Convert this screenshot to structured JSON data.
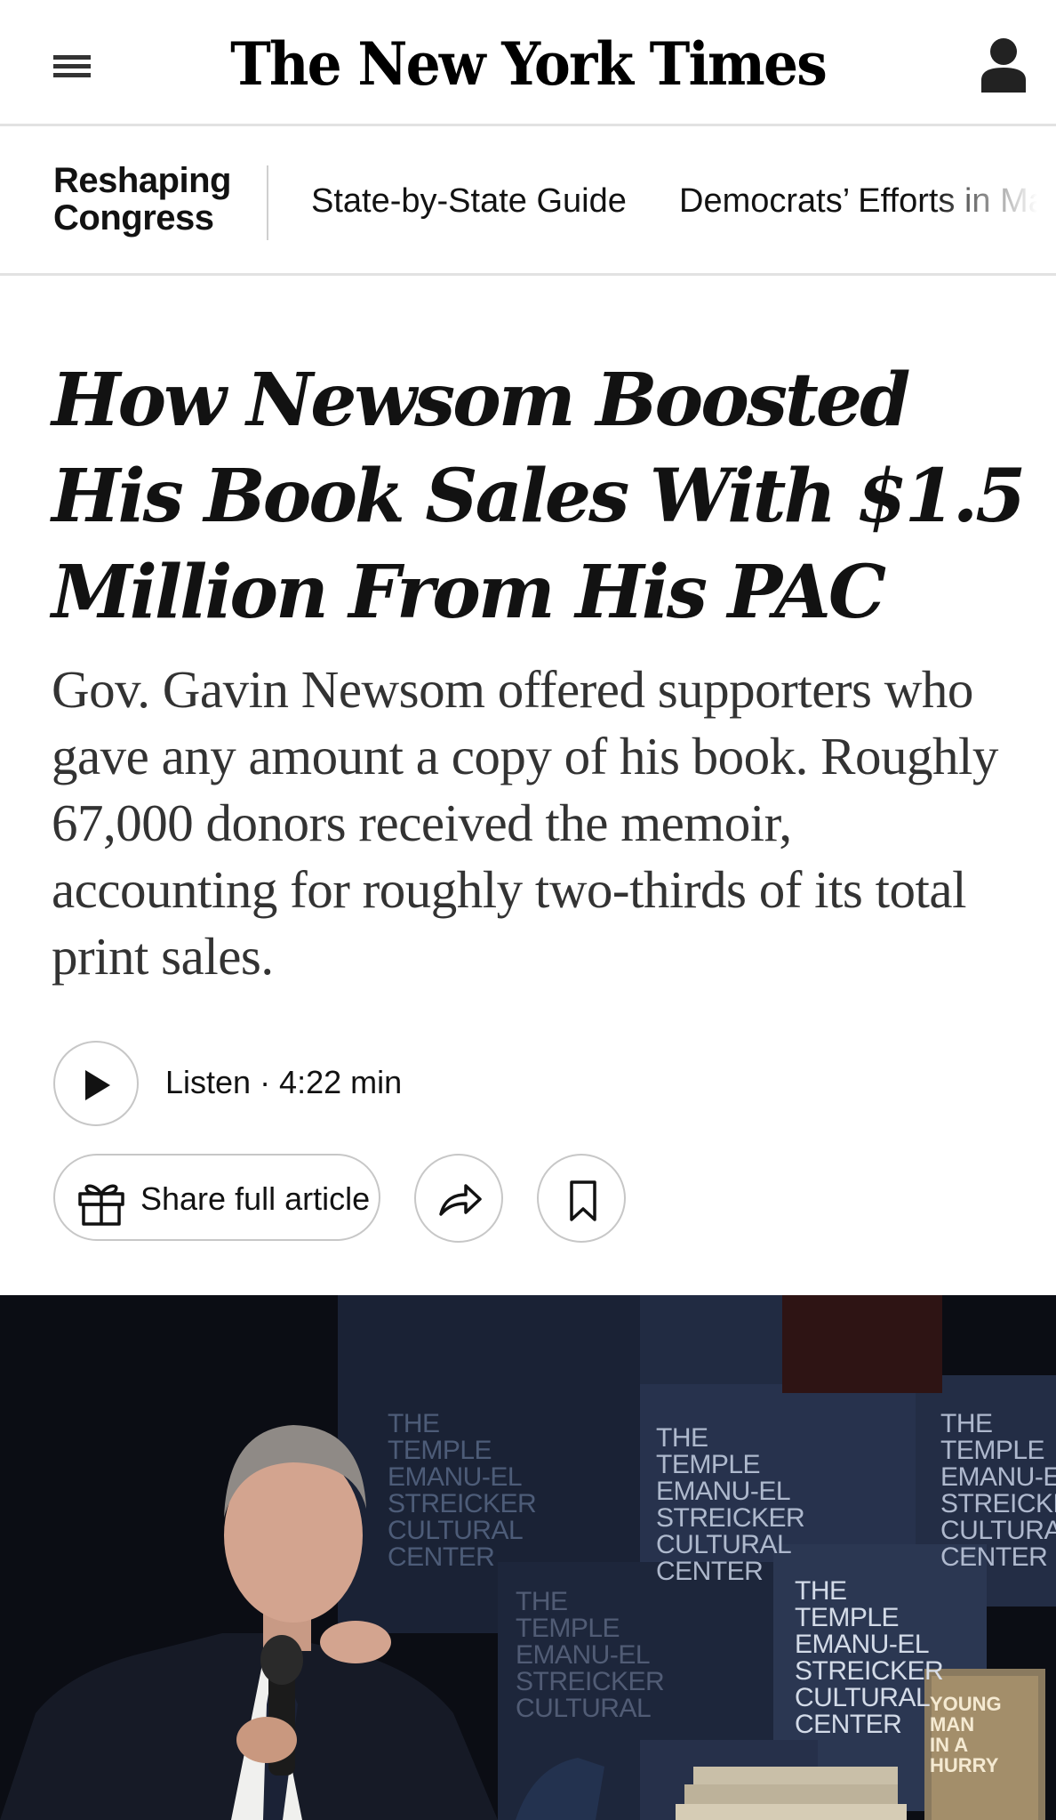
{
  "masthead": {
    "logo_text": "The New York Times",
    "menu_icon": "hamburger-menu-icon",
    "account_icon": "user-account-icon"
  },
  "section_nav": {
    "title_line1": "Reshaping",
    "title_line2": "Congress",
    "links": [
      "State-by-State Guide",
      "Democrats’ Efforts in Mar"
    ]
  },
  "article": {
    "headline": "How Newsom Boosted His Book Sales With $1.5 Million From His PAC",
    "summary": "Gov. Gavin Newsom offered supporters who gave any amount a copy of his book. Roughly 67,000 donors received the memoir, accounting for roughly two-thirds of its total print sales.",
    "listen_label": "Listen · 4:22 min",
    "share_full_label": "Share full article",
    "icons": {
      "play": "play-icon",
      "gift": "gift-icon",
      "share": "share-arrow-icon",
      "save": "bookmark-icon"
    }
  },
  "lead_image": {
    "backdrop_text_1": "THE\nTEMPLE\nEMANU-EL\nSTREICKER\nCULTURAL\nCENTER",
    "backdrop_text_2": "THE\nTEMPLE\nEMANU-EL\nSTREICKER\nCULTURAL\nCENTER",
    "backdrop_text_3": "THE\nTEMPLE\nEMANU-E\nSTREICKE\nCULTURA\nCENTER",
    "backdrop_text_4": "THE\nTEMPLE\nEMANU-EL\nSTREICKER\nCULTURAL\nCENTER",
    "backdrop_text_5": "THE\nTEMPLE\nEMANU-EL\nSTREICKER\nCULTURAL",
    "book_title": "YOUNG\nMAN\nIN A\nHURRY"
  },
  "colors": {
    "text_primary": "#121212",
    "text_summary": "#333333",
    "divider": "#e2e2e2",
    "button_border": "#c7c7c7",
    "image_bg": "#0b0d14"
  }
}
